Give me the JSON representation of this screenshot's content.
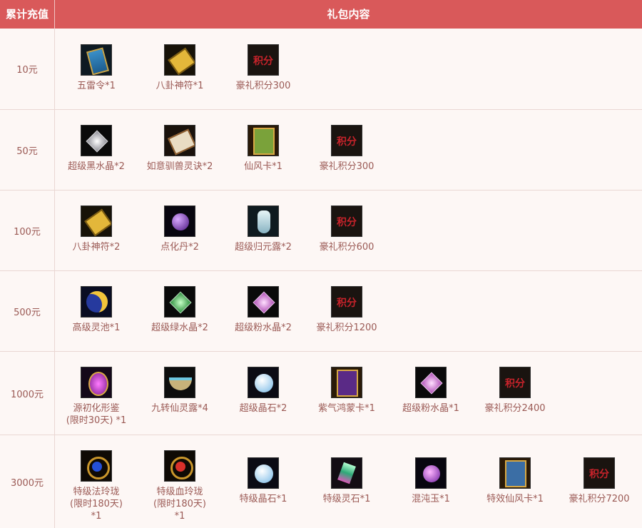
{
  "header": {
    "col1": "累计充值",
    "col2": "礼包内容"
  },
  "rows": [
    {
      "amount": "10元",
      "items": [
        {
          "icon": "command-token-icon",
          "label": "五雷令*1"
        },
        {
          "icon": "bagua-talisman-icon",
          "label": "八卦神符*1"
        },
        {
          "icon": "points-icon",
          "label": "豪礼积分300"
        }
      ]
    },
    {
      "amount": "50元",
      "items": [
        {
          "icon": "black-crystal-icon",
          "label": "超级黑水晶*2"
        },
        {
          "icon": "scroll-icon",
          "label": "如意驯兽灵诀*2"
        },
        {
          "icon": "card-icon",
          "label": "仙风卡*1"
        },
        {
          "icon": "points-icon",
          "label": "豪礼积分300"
        }
      ]
    },
    {
      "amount": "100元",
      "items": [
        {
          "icon": "bagua-talisman-icon",
          "label": "八卦神符*2"
        },
        {
          "icon": "purple-pill-icon",
          "label": "点化丹*2"
        },
        {
          "icon": "vase-icon",
          "label": "超级归元露*2"
        },
        {
          "icon": "points-icon",
          "label": "豪礼积分600"
        }
      ]
    },
    {
      "amount": "500元",
      "items": [
        {
          "icon": "moon-pool-icon",
          "label": "高级灵池*1"
        },
        {
          "icon": "green-crystal-icon",
          "label": "超级绿水晶*2"
        },
        {
          "icon": "pink-crystal-icon",
          "label": "超级粉水晶*2"
        },
        {
          "icon": "points-icon",
          "label": "豪礼积分1200"
        }
      ]
    },
    {
      "amount": "1000元",
      "items": [
        {
          "icon": "mirror-icon",
          "label": "源初化形鉴\n(限时30天) *1"
        },
        {
          "icon": "bowl-icon",
          "label": "九转仙灵露*4"
        },
        {
          "icon": "crystal-stone-icon",
          "label": "超级晶石*2"
        },
        {
          "icon": "purple-card-icon",
          "label": "紫气鸿蒙卡*1"
        },
        {
          "icon": "pink-crystal-icon",
          "label": "超级粉水晶*1"
        },
        {
          "icon": "points-icon",
          "label": "豪礼积分2400"
        }
      ]
    },
    {
      "amount": "3000元",
      "items": [
        {
          "icon": "blue-ring-icon",
          "label": "特级法玲珑\n(限时180天)\n*1"
        },
        {
          "icon": "red-ring-icon",
          "label": "特级血玲珑\n(限时180天)\n*1"
        },
        {
          "icon": "pearl-icon",
          "label": "特级晶石*1"
        },
        {
          "icon": "spirit-stone-icon",
          "label": "特级灵石*1"
        },
        {
          "icon": "chaos-jade-icon",
          "label": "混沌玉*1"
        },
        {
          "icon": "blue-card-icon",
          "label": "特效仙风卡*1"
        },
        {
          "icon": "points-icon",
          "label": "豪礼积分7200"
        }
      ]
    }
  ]
}
